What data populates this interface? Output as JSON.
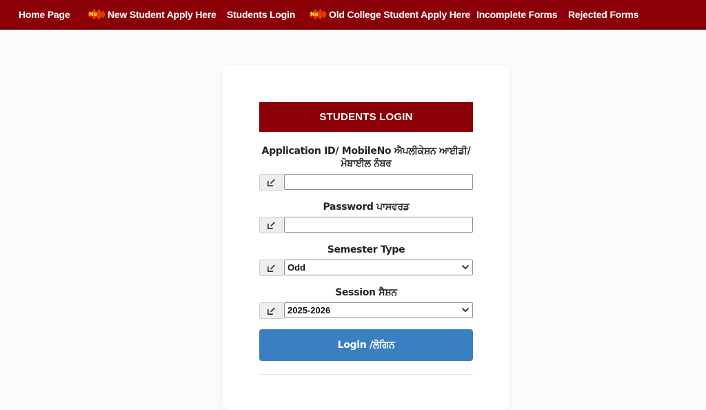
{
  "nav": {
    "items": [
      {
        "label": "Home Page",
        "badge": ""
      },
      {
        "label": "New Student Apply Here",
        "badge": "New"
      },
      {
        "label": "Students Login",
        "badge": ""
      },
      {
        "label": "Old College Student Apply Here",
        "badge": "New"
      },
      {
        "label": "Incomplete Forms",
        "badge": ""
      },
      {
        "label": "Rejected Forms",
        "badge": ""
      }
    ],
    "badge_text": "Ne"
  },
  "login": {
    "title": "STUDENTS LOGIN",
    "fields": {
      "application_id": {
        "label_line1": "Application ID/ MobileNo ਐਪਲੀਕੇਸ਼ਨ ਆਈਡੀ/",
        "label_line2": "ਮੋਬਾਈਲ ਨੰਬਰ",
        "value": "",
        "placeholder": ""
      },
      "password": {
        "label": "Password ਪਾਸਵਰਡ",
        "value": "",
        "placeholder": ""
      },
      "semester_type": {
        "label": "Semester Type",
        "selected": "Odd"
      },
      "session": {
        "label": "Session ਸੈਸ਼ਨ",
        "selected": "2025-2026"
      }
    },
    "button_label": "Login /ਲੋਗਿਨ"
  },
  "colors": {
    "nav_bg": "#8b0006",
    "header_bg": "#8b0006",
    "button_bg": "#3a7fc1",
    "badge_burst": "#e23a00",
    "badge_text": "#ffe14a"
  },
  "icons": {
    "field_addon": "edit-icon",
    "select_arrow": "chevron-down-icon"
  }
}
